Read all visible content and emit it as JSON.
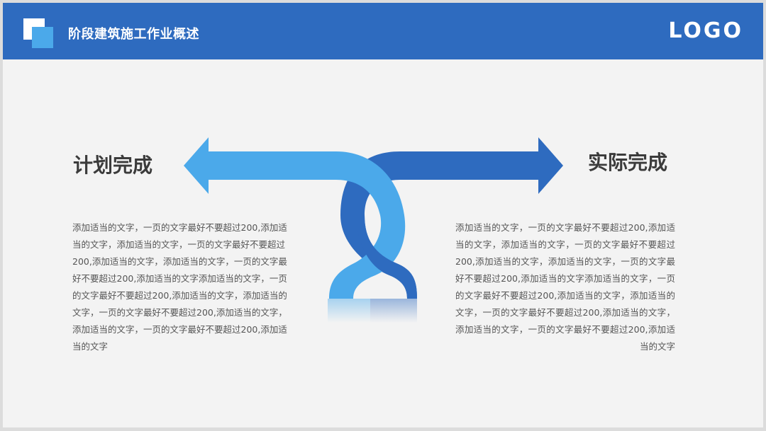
{
  "header": {
    "title": "阶段建筑施工作业概述",
    "logo": "LOGO",
    "colors": {
      "bar": "#2e6bbf",
      "accent": "#4ba9ea"
    }
  },
  "left": {
    "heading": "计划完成",
    "body": "添加适当的文字，一页的文字最好不要超过200,添加适当的文字，添加适当的文字，一页的文字最好不要超过200,添加适当的文字，添加适当的文字，一页的文字最好不要超过200,添加适当的文字添加适当的文字，一页的文字最好不要超过200,添加适当的文字，添加适当的文字，一页的文字最好不要超过200,添加适当的文字，添加适当的文字，一页的文字最好不要超过200,添加适当的文字"
  },
  "right": {
    "heading": "实际完成",
    "body": "添加适当的文字，一页的文字最好不要超过200,添加适当的文字，添加适当的文字，一页的文字最好不要超过200,添加适当的文字，添加适当的文字，一页的文字最好不要超过200,添加适当的文字添加适当的文字，一页的文字最好不要超过200,添加适当的文字，添加适当的文字，一页的文字最好不要超过200,添加适当的文字，添加适当的文字，一页的文字最好不要超过200,添加适当的文字"
  },
  "graphic": {
    "icon": "intertwined-arrows-icon",
    "colors": {
      "light": "#4ba9ea",
      "dark": "#2e6bbf"
    }
  }
}
